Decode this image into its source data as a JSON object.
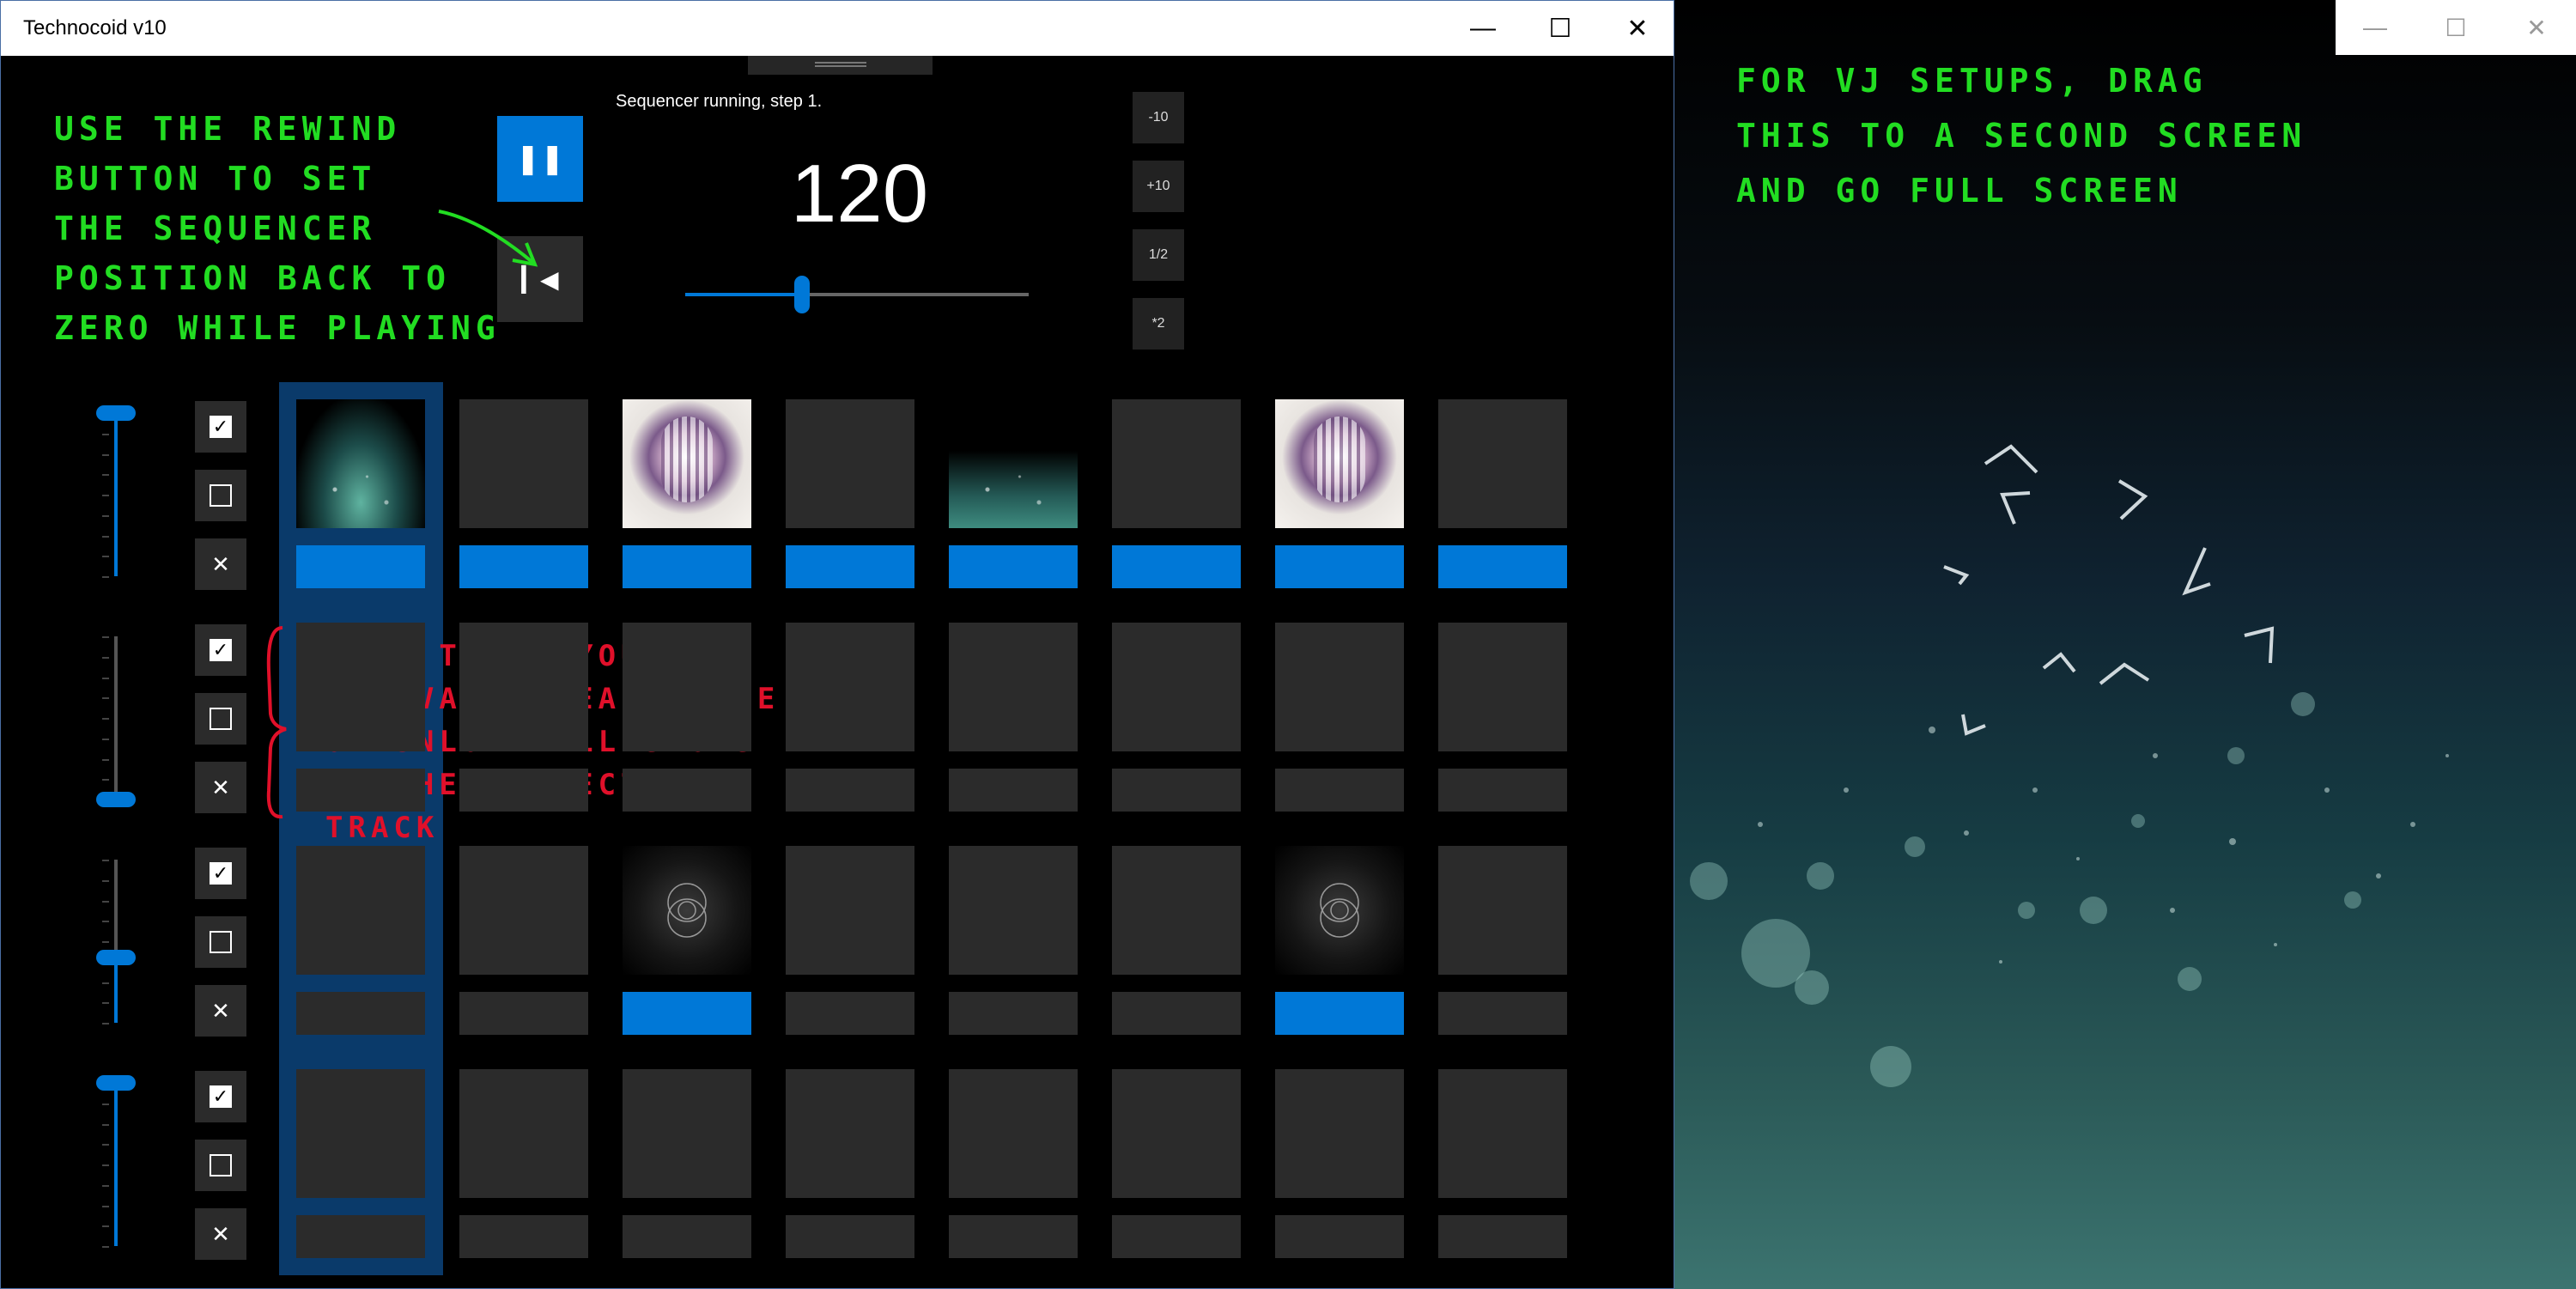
{
  "window": {
    "title": "Technocoid v10",
    "minimize_icon": "minimize-icon",
    "maximize_icon": "maximize-icon",
    "close_icon": "close-icon"
  },
  "transport": {
    "pause_icon": "pause-icon",
    "rewind_icon": "rewind-icon",
    "status": "Sequencer running, step 1.",
    "bpm": "120",
    "bpm_slider_fraction": 0.34,
    "buttons": [
      "-10",
      "+10",
      "1/2",
      "*2"
    ]
  },
  "tracks": [
    {
      "volume": 1.0,
      "slots": [
        "particles",
        "empty",
        "mandala",
        "empty",
        "particles-small",
        "empty",
        "mandala",
        "empty"
      ],
      "active": [
        true,
        true,
        true,
        true,
        true,
        true,
        true,
        true
      ]
    },
    {
      "volume": 0.0,
      "slots": [
        "empty",
        "empty",
        "empty",
        "empty",
        "empty",
        "empty",
        "empty",
        "empty"
      ],
      "active": [
        false,
        false,
        false,
        false,
        false,
        false,
        false,
        false
      ]
    },
    {
      "volume": 0.4,
      "slots": [
        "empty",
        "empty",
        "circles",
        "empty",
        "empty",
        "empty",
        "circles",
        "empty"
      ],
      "active": [
        false,
        false,
        true,
        false,
        false,
        false,
        true,
        false
      ]
    },
    {
      "volume": 1.0,
      "slots": [
        "empty",
        "empty",
        "empty",
        "empty",
        "empty",
        "empty",
        "empty",
        "empty"
      ],
      "active": [
        false,
        false,
        false,
        false,
        false,
        false,
        false,
        false
      ]
    }
  ],
  "track_buttons": {
    "activate_icon": "checkbox-checked-icon",
    "deactivate_icon": "checkbox-empty-icon",
    "unload_icon": "close-x-icon"
  },
  "annotations": {
    "rewind": "USE THE REWIND\nBUTTON TO SET\nTHE SEQUENCER\nPOSITION BACK TO\nZERO WHILE PLAYING",
    "tracks": "WITH THESE YOU CAN\nACTIVATE, DEACTIVATE\nOR UNLOAD ALL SLOTS\nIN THE RESPECTIVE\nTRACK",
    "second_screen": "FOR VJ SETUPS, DRAG\nTHIS TO A SECOND SCREEN\nAND GO FULL SCREEN"
  },
  "colors": {
    "accent": "#0078d7",
    "annotation_green": "#22dd22",
    "annotation_red": "#e0102a"
  }
}
